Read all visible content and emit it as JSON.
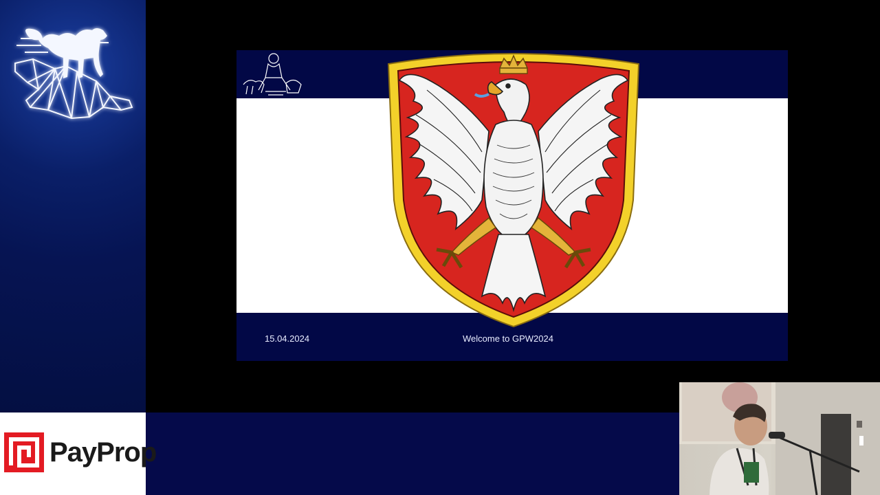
{
  "slide": {
    "date": "15.04.2024",
    "welcome": "Welcome to GPW2024"
  },
  "sponsor": {
    "name": "PayProp",
    "brand_color": "#e31b23"
  },
  "conference_logo": {
    "icon": "camel-icon"
  },
  "webcam": {
    "description_icon": "speaker-video-feed"
  },
  "colors": {
    "sidebar": "#061453",
    "slide_band": "#020846",
    "coat_red": "#d7251f",
    "coat_gold": "#f3d12a"
  }
}
